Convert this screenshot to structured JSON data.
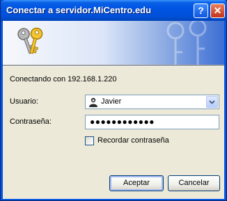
{
  "window": {
    "title": "Conectar a servidor.MiCentro.edu",
    "help_label": "?",
    "close_label": "✕"
  },
  "dialog": {
    "connecting_text": "Conectando con 192.168.1.220",
    "user_label": "Usuario:",
    "user_value": "Javier",
    "password_label": "Contraseña:",
    "password_value": "●●●●●●●●●●●●",
    "remember_label": "Recordar contraseña",
    "remember_checked": false,
    "ok_label": "Aceptar",
    "cancel_label": "Cancelar"
  },
  "icons": {
    "banner": "keys-icon",
    "user_combo": "user-avatar-icon",
    "dropdown": "chevron-down-icon"
  },
  "colors": {
    "titlebar": "#0054E3",
    "dialog_bg": "#ECE9D8",
    "close_button": "#C2321A"
  }
}
